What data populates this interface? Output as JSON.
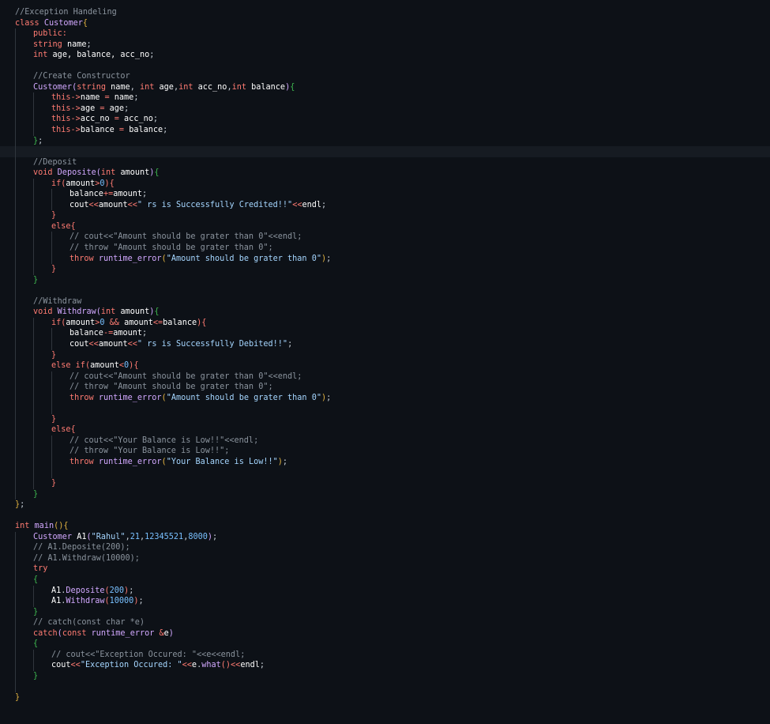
{
  "editor": {
    "lines": [
      {
        "d": 0,
        "t": [
          [
            "cmt",
            "//Exception Handeling"
          ]
        ]
      },
      {
        "d": 0,
        "t": [
          [
            "kw",
            "class "
          ],
          [
            "fn",
            "Customer"
          ],
          [
            "b1",
            "{"
          ]
        ]
      },
      {
        "d": 1,
        "t": [
          [
            "kw",
            "public:"
          ]
        ]
      },
      {
        "d": 1,
        "t": [
          [
            "kw",
            "string "
          ],
          [
            "var",
            "name"
          ],
          [
            "p",
            ";"
          ]
        ]
      },
      {
        "d": 1,
        "t": [
          [
            "kw",
            "int "
          ],
          [
            "var",
            "age, balance, acc_no"
          ],
          [
            "p",
            ";"
          ]
        ]
      },
      {
        "d": 1,
        "t": []
      },
      {
        "d": 1,
        "t": [
          [
            "cmt",
            "//Create Constructor"
          ]
        ]
      },
      {
        "d": 1,
        "t": [
          [
            "fn",
            "Customer"
          ],
          [
            "b2",
            "("
          ],
          [
            "kw",
            "string "
          ],
          [
            "var",
            "name"
          ],
          [
            "p",
            ", "
          ],
          [
            "kw",
            "int "
          ],
          [
            "var",
            "age"
          ],
          [
            "p",
            ","
          ],
          [
            "kw",
            "int "
          ],
          [
            "var",
            "acc_no"
          ],
          [
            "p",
            ","
          ],
          [
            "kw",
            "int "
          ],
          [
            "var",
            "balance"
          ],
          [
            "b2",
            ")"
          ],
          [
            "b3",
            "{"
          ]
        ]
      },
      {
        "d": 2,
        "t": [
          [
            "kw",
            "this"
          ],
          [
            "op",
            "->"
          ],
          [
            "var",
            "name "
          ],
          [
            "op",
            "= "
          ],
          [
            "var",
            "name"
          ],
          [
            "p",
            ";"
          ]
        ]
      },
      {
        "d": 2,
        "t": [
          [
            "kw",
            "this"
          ],
          [
            "op",
            "->"
          ],
          [
            "var",
            "age "
          ],
          [
            "op",
            "= "
          ],
          [
            "var",
            "age"
          ],
          [
            "p",
            ";"
          ]
        ]
      },
      {
        "d": 2,
        "t": [
          [
            "kw",
            "this"
          ],
          [
            "op",
            "->"
          ],
          [
            "var",
            "acc_no "
          ],
          [
            "op",
            "= "
          ],
          [
            "var",
            "acc_no"
          ],
          [
            "p",
            ";"
          ]
        ]
      },
      {
        "d": 2,
        "t": [
          [
            "kw",
            "this"
          ],
          [
            "op",
            "->"
          ],
          [
            "var",
            "balance "
          ],
          [
            "op",
            "= "
          ],
          [
            "var",
            "balance"
          ],
          [
            "p",
            ";"
          ]
        ]
      },
      {
        "d": 1,
        "t": [
          [
            "b3",
            "}"
          ],
          [
            "p",
            ";"
          ]
        ]
      },
      {
        "d": 1,
        "t": [],
        "hl": true
      },
      {
        "d": 1,
        "t": [
          [
            "cmt",
            "//Deposit"
          ]
        ]
      },
      {
        "d": 1,
        "t": [
          [
            "kw",
            "void "
          ],
          [
            "fn",
            "Deposite"
          ],
          [
            "b2",
            "("
          ],
          [
            "kw",
            "int "
          ],
          [
            "var",
            "amount"
          ],
          [
            "b2",
            ")"
          ],
          [
            "b3",
            "{"
          ]
        ]
      },
      {
        "d": 2,
        "t": [
          [
            "kw",
            "if"
          ],
          [
            "b4",
            "("
          ],
          [
            "var",
            "amount"
          ],
          [
            "op",
            ">"
          ],
          [
            "num",
            "0"
          ],
          [
            "b4",
            ")"
          ],
          [
            "b4",
            "{"
          ]
        ]
      },
      {
        "d": 3,
        "t": [
          [
            "var",
            "balance"
          ],
          [
            "op",
            "+="
          ],
          [
            "var",
            "amount"
          ],
          [
            "p",
            ";"
          ]
        ]
      },
      {
        "d": 3,
        "t": [
          [
            "var",
            "cout"
          ],
          [
            "op",
            "<<"
          ],
          [
            "var",
            "amount"
          ],
          [
            "op",
            "<<"
          ],
          [
            "str",
            "\" rs is Successfully Credited!!\""
          ],
          [
            "op",
            "<<"
          ],
          [
            "var",
            "endl"
          ],
          [
            "p",
            ";"
          ]
        ]
      },
      {
        "d": 2,
        "t": [
          [
            "b4",
            "}"
          ]
        ]
      },
      {
        "d": 2,
        "t": [
          [
            "kw",
            "else"
          ],
          [
            "b4",
            "{"
          ]
        ]
      },
      {
        "d": 3,
        "t": [
          [
            "cmt",
            "// cout<<\"Amount should be grater than 0\"<<endl;"
          ]
        ]
      },
      {
        "d": 3,
        "t": [
          [
            "cmt",
            "// throw \"Amount should be grater than 0\";"
          ]
        ]
      },
      {
        "d": 3,
        "t": [
          [
            "kw",
            "throw "
          ],
          [
            "fn",
            "runtime_error"
          ],
          [
            "b1",
            "("
          ],
          [
            "str",
            "\"Amount should be grater than 0\""
          ],
          [
            "b1",
            ")"
          ],
          [
            "p",
            ";"
          ]
        ]
      },
      {
        "d": 2,
        "t": [
          [
            "b4",
            "}"
          ]
        ]
      },
      {
        "d": 1,
        "t": [
          [
            "b3",
            "}"
          ]
        ]
      },
      {
        "d": 1,
        "t": []
      },
      {
        "d": 1,
        "t": [
          [
            "cmt",
            "//Withdraw"
          ]
        ]
      },
      {
        "d": 1,
        "t": [
          [
            "kw",
            "void "
          ],
          [
            "fn",
            "Withdraw"
          ],
          [
            "b2",
            "("
          ],
          [
            "kw",
            "int "
          ],
          [
            "var",
            "amount"
          ],
          [
            "b2",
            ")"
          ],
          [
            "b3",
            "{"
          ]
        ]
      },
      {
        "d": 2,
        "t": [
          [
            "kw",
            "if"
          ],
          [
            "b4",
            "("
          ],
          [
            "var",
            "amount"
          ],
          [
            "op",
            ">"
          ],
          [
            "num",
            "0 "
          ],
          [
            "op",
            "&& "
          ],
          [
            "var",
            "amount"
          ],
          [
            "op",
            "<="
          ],
          [
            "var",
            "balance"
          ],
          [
            "b4",
            ")"
          ],
          [
            "b4",
            "{"
          ]
        ]
      },
      {
        "d": 3,
        "t": [
          [
            "var",
            "balance"
          ],
          [
            "op",
            "-="
          ],
          [
            "var",
            "amount"
          ],
          [
            "p",
            ";"
          ]
        ]
      },
      {
        "d": 3,
        "t": [
          [
            "var",
            "cout"
          ],
          [
            "op",
            "<<"
          ],
          [
            "var",
            "amount"
          ],
          [
            "op",
            "<<"
          ],
          [
            "str",
            "\" rs is Successfully Debited!!\""
          ],
          [
            "p",
            ";"
          ]
        ]
      },
      {
        "d": 2,
        "t": [
          [
            "b4",
            "}"
          ]
        ]
      },
      {
        "d": 2,
        "t": [
          [
            "kw",
            "else if"
          ],
          [
            "b4",
            "("
          ],
          [
            "var",
            "amount"
          ],
          [
            "op",
            "<"
          ],
          [
            "num",
            "0"
          ],
          [
            "b4",
            ")"
          ],
          [
            "b4",
            "{"
          ]
        ]
      },
      {
        "d": 3,
        "t": [
          [
            "cmt",
            "// cout<<\"Amount should be grater than 0\"<<endl;"
          ]
        ]
      },
      {
        "d": 3,
        "t": [
          [
            "cmt",
            "// throw \"Amount should be grater than 0\";"
          ]
        ]
      },
      {
        "d": 3,
        "t": [
          [
            "kw",
            "throw "
          ],
          [
            "fn",
            "runtime_error"
          ],
          [
            "b1",
            "("
          ],
          [
            "str",
            "\"Amount should be grater than 0\""
          ],
          [
            "b1",
            ")"
          ],
          [
            "p",
            ";"
          ]
        ]
      },
      {
        "d": 3,
        "t": []
      },
      {
        "d": 2,
        "t": [
          [
            "b4",
            "}"
          ]
        ]
      },
      {
        "d": 2,
        "t": [
          [
            "kw",
            "else"
          ],
          [
            "b4",
            "{"
          ]
        ]
      },
      {
        "d": 3,
        "t": [
          [
            "cmt",
            "// cout<<\"Your Balance is Low!!\"<<endl;"
          ]
        ]
      },
      {
        "d": 3,
        "t": [
          [
            "cmt",
            "// throw \"Your Balance is Low!!\";"
          ]
        ]
      },
      {
        "d": 3,
        "t": [
          [
            "kw",
            "throw "
          ],
          [
            "fn",
            "runtime_error"
          ],
          [
            "b1",
            "("
          ],
          [
            "str",
            "\"Your Balance is Low!!\""
          ],
          [
            "b1",
            ")"
          ],
          [
            "p",
            ";"
          ]
        ]
      },
      {
        "d": 3,
        "t": []
      },
      {
        "d": 2,
        "t": [
          [
            "b4",
            "}"
          ]
        ]
      },
      {
        "d": 1,
        "t": [
          [
            "b3",
            "}"
          ]
        ]
      },
      {
        "d": 0,
        "t": [
          [
            "b1",
            "}"
          ],
          [
            "p",
            ";"
          ]
        ]
      },
      {
        "d": 0,
        "t": []
      },
      {
        "d": 0,
        "t": [
          [
            "kw",
            "int "
          ],
          [
            "fn",
            "main"
          ],
          [
            "b1",
            "()"
          ],
          [
            "b1",
            "{"
          ]
        ]
      },
      {
        "d": 1,
        "t": [
          [
            "fn",
            "Customer "
          ],
          [
            "var",
            "A1"
          ],
          [
            "b2",
            "("
          ],
          [
            "str",
            "\"Rahul\""
          ],
          [
            "p",
            ","
          ],
          [
            "num",
            "21"
          ],
          [
            "p",
            ","
          ],
          [
            "num",
            "12345521"
          ],
          [
            "p",
            ","
          ],
          [
            "num",
            "8000"
          ],
          [
            "b2",
            ")"
          ],
          [
            "p",
            ";"
          ]
        ]
      },
      {
        "d": 1,
        "t": [
          [
            "cmt",
            "// A1.Deposite(200);"
          ]
        ]
      },
      {
        "d": 1,
        "t": [
          [
            "cmt",
            "// A1.Withdraw(10000);"
          ]
        ]
      },
      {
        "d": 1,
        "t": [
          [
            "kw",
            "try"
          ]
        ]
      },
      {
        "d": 1,
        "t": [
          [
            "b3",
            "{"
          ]
        ]
      },
      {
        "d": 2,
        "t": [
          [
            "var",
            "A1"
          ],
          [
            "p",
            "."
          ],
          [
            "fn",
            "Deposite"
          ],
          [
            "b4",
            "("
          ],
          [
            "num",
            "200"
          ],
          [
            "b4",
            ")"
          ],
          [
            "p",
            ";"
          ]
        ]
      },
      {
        "d": 2,
        "t": [
          [
            "var",
            "A1"
          ],
          [
            "p",
            "."
          ],
          [
            "fn",
            "Withdraw"
          ],
          [
            "b4",
            "("
          ],
          [
            "num",
            "10000"
          ],
          [
            "b4",
            ")"
          ],
          [
            "p",
            ";"
          ]
        ]
      },
      {
        "d": 1,
        "t": [
          [
            "b3",
            "}"
          ]
        ]
      },
      {
        "d": 1,
        "t": [
          [
            "cmt",
            "// catch(const char *e)"
          ]
        ]
      },
      {
        "d": 1,
        "t": [
          [
            "kw",
            "catch"
          ],
          [
            "b2",
            "("
          ],
          [
            "kw",
            "const "
          ],
          [
            "fn",
            "runtime_error "
          ],
          [
            "op",
            "&"
          ],
          [
            "var",
            "e"
          ],
          [
            "b2",
            ")"
          ]
        ]
      },
      {
        "d": 1,
        "t": [
          [
            "b3",
            "{"
          ]
        ]
      },
      {
        "d": 2,
        "t": [
          [
            "cmt",
            "// cout<<\"Exception Occured: \"<<e<<endl;"
          ]
        ]
      },
      {
        "d": 2,
        "t": [
          [
            "var",
            "cout"
          ],
          [
            "op",
            "<<"
          ],
          [
            "str",
            "\"Exception Occured: \""
          ],
          [
            "op",
            "<<"
          ],
          [
            "var",
            "e"
          ],
          [
            "p",
            "."
          ],
          [
            "fn",
            "what"
          ],
          [
            "b4",
            "()"
          ],
          [
            "op",
            "<<"
          ],
          [
            "var",
            "endl"
          ],
          [
            "p",
            ";"
          ]
        ]
      },
      {
        "d": 1,
        "t": [
          [
            "b3",
            "}"
          ]
        ]
      },
      {
        "d": 1,
        "t": []
      },
      {
        "d": 0,
        "t": [
          [
            "b1",
            "}"
          ]
        ]
      }
    ]
  }
}
